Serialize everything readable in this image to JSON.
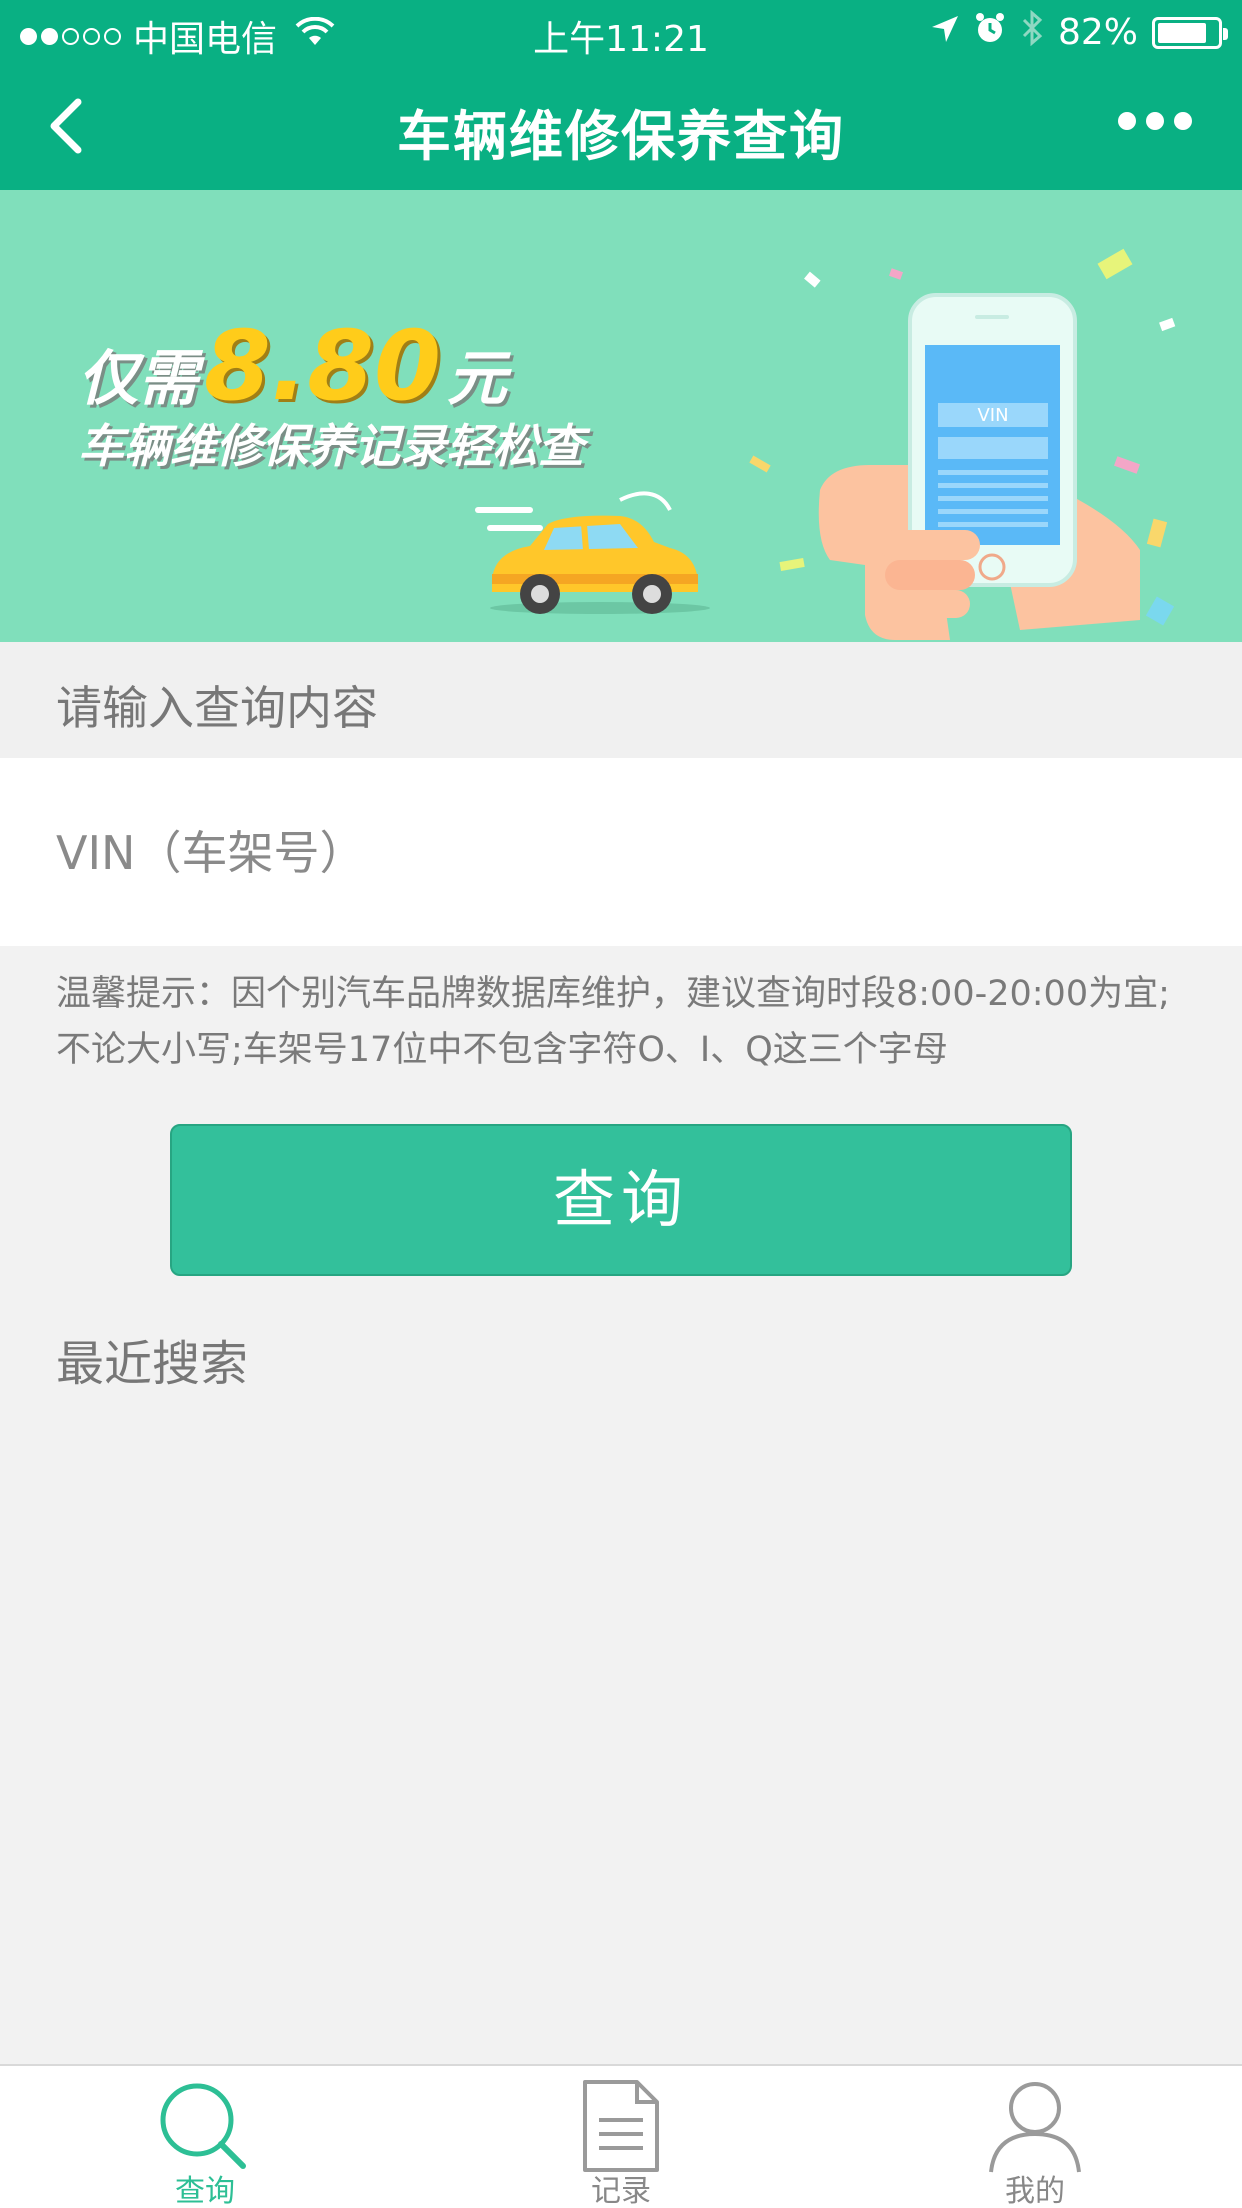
{
  "status_bar": {
    "carrier": "中国电信",
    "time": "上午11:21",
    "battery_percent": "82%",
    "battery_level": 0.82,
    "signal_bars_filled": 2,
    "signal_bars_total": 5
  },
  "nav": {
    "title": "车辆维修保养查询",
    "back_icon": "chevron-left-icon",
    "more_icon": "more-dots-icon"
  },
  "banner": {
    "prefix": "仅需",
    "price": "8.80",
    "suffix": "元",
    "subtitle": "车辆维修保养记录轻松查",
    "phone_text": "VIN"
  },
  "form": {
    "label": "请输入查询内容",
    "vin_placeholder": "VIN（车架号）",
    "tip": "温馨提示：因个别汽车品牌数据库维护，建议查询时段8:00-20:00为宜;不论大小写;车架号17位中不包含字符O、I、Q这三个字母",
    "query_button": "查询",
    "recent_label": "最近搜索"
  },
  "tabs": [
    {
      "label": "查询",
      "icon": "search-icon",
      "active": true
    },
    {
      "label": "记录",
      "icon": "document-icon",
      "active": false
    },
    {
      "label": "我的",
      "icon": "user-icon",
      "active": false
    }
  ],
  "colors": {
    "primary": "#09b083",
    "button": "#33c09b",
    "banner_bg": "#80dfbb",
    "tab_active": "#2dbf95"
  }
}
